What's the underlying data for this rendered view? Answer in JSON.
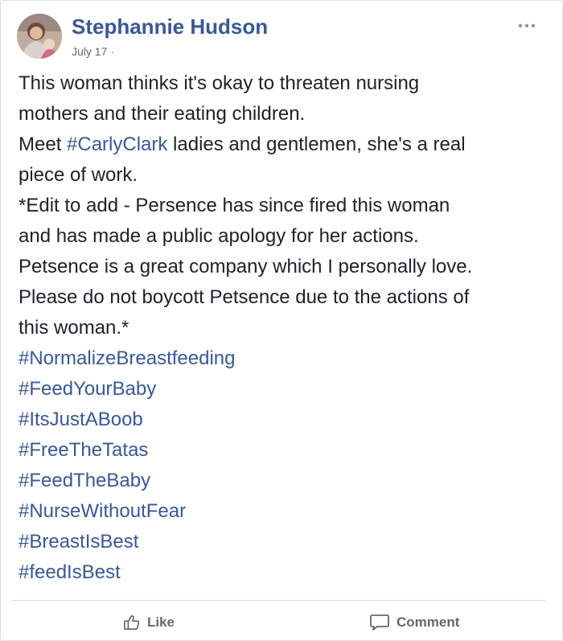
{
  "post": {
    "author": "Stephannie Hudson",
    "date": "July 17",
    "audience_separator": "·",
    "menu_icon": "more-horizontal-icon",
    "lines": [
      "This woman thinks it's okay to threaten nursing",
      "mothers and their eating children."
    ],
    "meet_line": {
      "before": "Meet ",
      "tag": "#CarlyClark",
      "after": " ladies and gentlemen, she's a real"
    },
    "lines2": [
      "piece of work.",
      "*Edit to add - Persence has since fired this woman",
      "and has made a public apology for her actions.",
      "Petsence is a great company which I personally love.",
      "Please do not boycott Petsence due to the actions of",
      "this woman.*"
    ],
    "hashtags": [
      "#NormalizeBreastfeeding",
      "#FeedYourBaby",
      "#ItsJustABoob",
      "#FreeTheTatas",
      "#FeedTheBaby",
      "#NurseWithoutFear",
      "#BreastIsBest",
      "#feedIsBest"
    ]
  },
  "actions": {
    "like_label": "Like",
    "like_icon": "thumbs-up-icon",
    "comment_label": "Comment",
    "comment_icon": "speech-bubble-icon"
  },
  "colors": {
    "link": "#385898",
    "text": "#1d2129",
    "meta": "#616770",
    "action": "#606770"
  }
}
